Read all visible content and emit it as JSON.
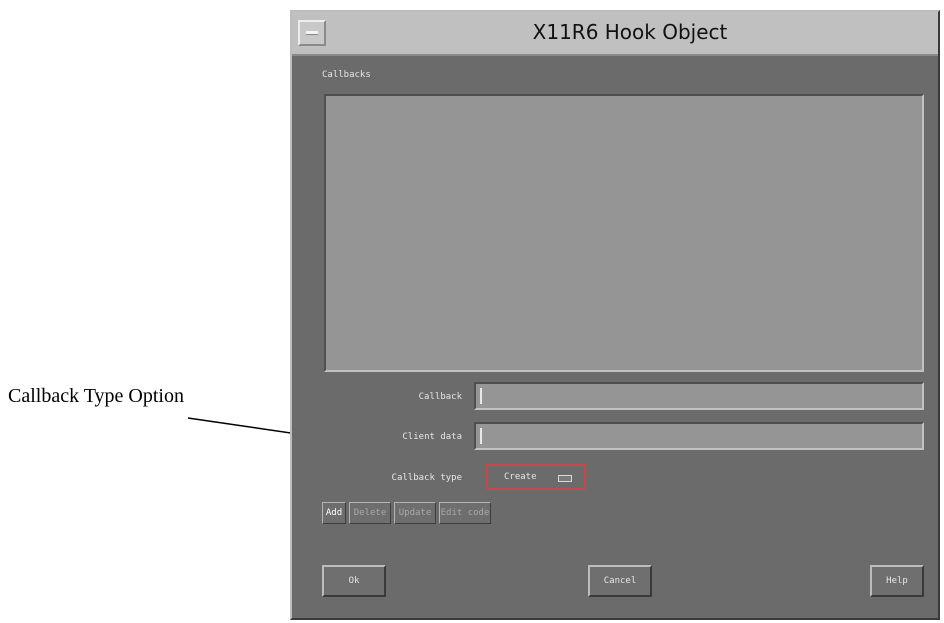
{
  "annotation": {
    "text": "Callback Type Option"
  },
  "window": {
    "title": "X11R6 Hook Object"
  },
  "callbacks": {
    "label": "Callbacks"
  },
  "fields": {
    "callback": {
      "label": "Callback",
      "value": ""
    },
    "client_data": {
      "label": "Client data",
      "value": ""
    },
    "callback_type": {
      "label": "Callback type",
      "value": "Create"
    }
  },
  "list_buttons": {
    "add": "Add",
    "delete": "Delete",
    "update": "Update",
    "edit_code": "Edit code"
  },
  "dialog_buttons": {
    "ok": "Ok",
    "cancel": "Cancel",
    "help": "Help"
  },
  "colors": {
    "background": "#6b6b6b",
    "titlebar": "#c0c0c0",
    "list_bg": "#959595",
    "option_highlight": "#c8484a"
  },
  "icons": {
    "window_menu": "window-menu-icon",
    "option_indicator": "option-menu-indicator-icon",
    "text_cursor": "text-cursor-icon"
  }
}
